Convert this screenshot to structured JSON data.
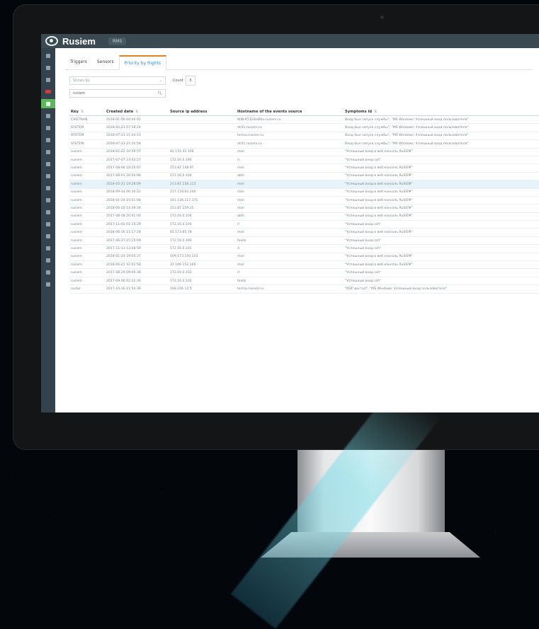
{
  "app": {
    "brand": "Rusiem",
    "top_menu": "RMS"
  },
  "tabs": [
    {
      "label": "Triggers"
    },
    {
      "label": "Sensors"
    },
    {
      "label": "Priority by Rights"
    }
  ],
  "filter": {
    "select_value": "Shows by",
    "count_label": "Count",
    "count_value": "3"
  },
  "search": {
    "value": "rusiem"
  },
  "table": {
    "headers": [
      "Key",
      "Created date",
      "Source ip address",
      "Hostname of the events source",
      "Symptoms id"
    ],
    "rows": [
      [
        "CIKETNAN",
        "2018-01-06 04:00:02",
        "",
        "WIN-K51G6eB6u-rusiem.ru",
        "Вход был запуск службы\", \"MS Windows: Успешный вход пользователя\""
      ],
      [
        "SYSTEM",
        "2018-02-21 07:18:24",
        "",
        "dc01.rusiem.ru",
        "Вход был запуск службы\", \"MS Windows: Успешный вход пользователя\""
      ],
      [
        "SYSTEM",
        "2018-07-23 21:04:13",
        "",
        "terma.rusiem.ru",
        "Вход был запуск службы\", \"MS Windows: Успешный вход пользователя\""
      ],
      [
        "SYSTEM",
        "2018-07-23 21:20:58",
        "",
        "dc01.rusiem.ru",
        "Вход был запуск службы\", \"MS Windows: Успешный вход пользователя\""
      ],
      [
        "rusiem",
        "2018-02-22 10:39:57",
        "82.155.41.106",
        "rlsel",
        "\"Успешный вход в веб консоль RuSIEM\""
      ],
      [
        "rusiem",
        "2017-07-07 23:02:57",
        "172.16.0.190",
        "rl",
        "\"Успешный вход ssh\""
      ],
      [
        "rusiem",
        "2017-08-04 18:25:07",
        "213.87.148.97",
        "rlsel",
        "\"Успешный вход в веб консоль RuSIEM\""
      ],
      [
        "rusiem",
        "2017-08-01 20:50:06",
        "172.16.0.104",
        "abhi",
        "\"Успешный вход в веб консоль RuSIEM\""
      ],
      [
        "rusiem",
        "2018-05-21 19:28:09",
        "213.87.158.113",
        "rlsel",
        "\"Успешный вход в веб консоль RuSIEM\""
      ],
      [
        "rusiem",
        "2018-09-14 06:30:22",
        "217.118.83.240",
        "rlsel",
        "\"Успешный вход в веб консоль RuSIEM\""
      ],
      [
        "rusiem",
        "2018-01-24 15:01:08",
        "141.136.117.171",
        "rlsel",
        "\"Успешный вход в веб консоль RuSIEM\""
      ],
      [
        "rusiem",
        "2018-06-20 14:49:34",
        "213.87.159.35",
        "rlsel",
        "\"Успешный вход в веб консоль RuSIEM\""
      ],
      [
        "rusiem",
        "2017-08-18 20:41:00",
        "172.16.0.104",
        "abhi",
        "\"Успешный вход в веб консоль RuSIEM\""
      ],
      [
        "rusiem",
        "2017-11-03 01:15:29",
        "172.16.0.104",
        "rl",
        "\"Успешный вход ssh\""
      ],
      [
        "rusiem",
        "2018-06-16 11:17:28",
        "81.173.65.78",
        "rlsel",
        "\"Успешный вход в веб консоль RuSIEM\""
      ],
      [
        "rusiem",
        "2017-06-27 15:15:09",
        "172.16.0.190",
        "feeds",
        "\"Успешный вход ssh\""
      ],
      [
        "rusiem",
        "2017-11-13 13:08:59",
        "172.16.0.101",
        "rl",
        "\"Успешный вход ssh\""
      ],
      [
        "rusiem",
        "2018-01-24 19:05:37",
        "109.173.150.103",
        "rlsel",
        "\"Успешный вход в веб консоль RuSIEM\""
      ],
      [
        "rusiem",
        "2018-06-21 12:02:58",
        "37.106.152.166",
        "rlsel",
        "\"Успешный вход в веб консоль RuSIEM\""
      ],
      [
        "rusiem",
        "2017-08-29 09:06:38",
        "172.16.0.102",
        "rl",
        "\"Успешный вход ssh\""
      ],
      [
        "rusiem",
        "2017-09-06 02:22:36",
        "172.16.0.102",
        "feeds",
        "\"Успешный вход ssh\""
      ],
      [
        "rantal",
        "2017-10-16 11:50:39",
        "168.236.12.5",
        "terma.rusiem.ru",
        "\"RDP доступ\", \"MS Windows: Успешный вход пользователя\""
      ]
    ]
  },
  "nav_icons": [
    "home-icon",
    "menu-icon",
    "chart-icon",
    "alert-icon",
    "dashboard-icon",
    "list-icon",
    "filter-icon",
    "settings-icon",
    "user-icon",
    "clock-icon",
    "map-icon",
    "link-icon",
    "search-icon",
    "database-icon",
    "gear-icon",
    "flag-icon",
    "info-icon",
    "lock-icon",
    "cloud-icon",
    "tag-icon"
  ],
  "colors": {
    "topbar": "#3b4a52",
    "sidenav": "#34434b",
    "accent_tab": "#e67e22",
    "active_nav": "#5cb85c",
    "alert_badge": "#d63b3b"
  }
}
